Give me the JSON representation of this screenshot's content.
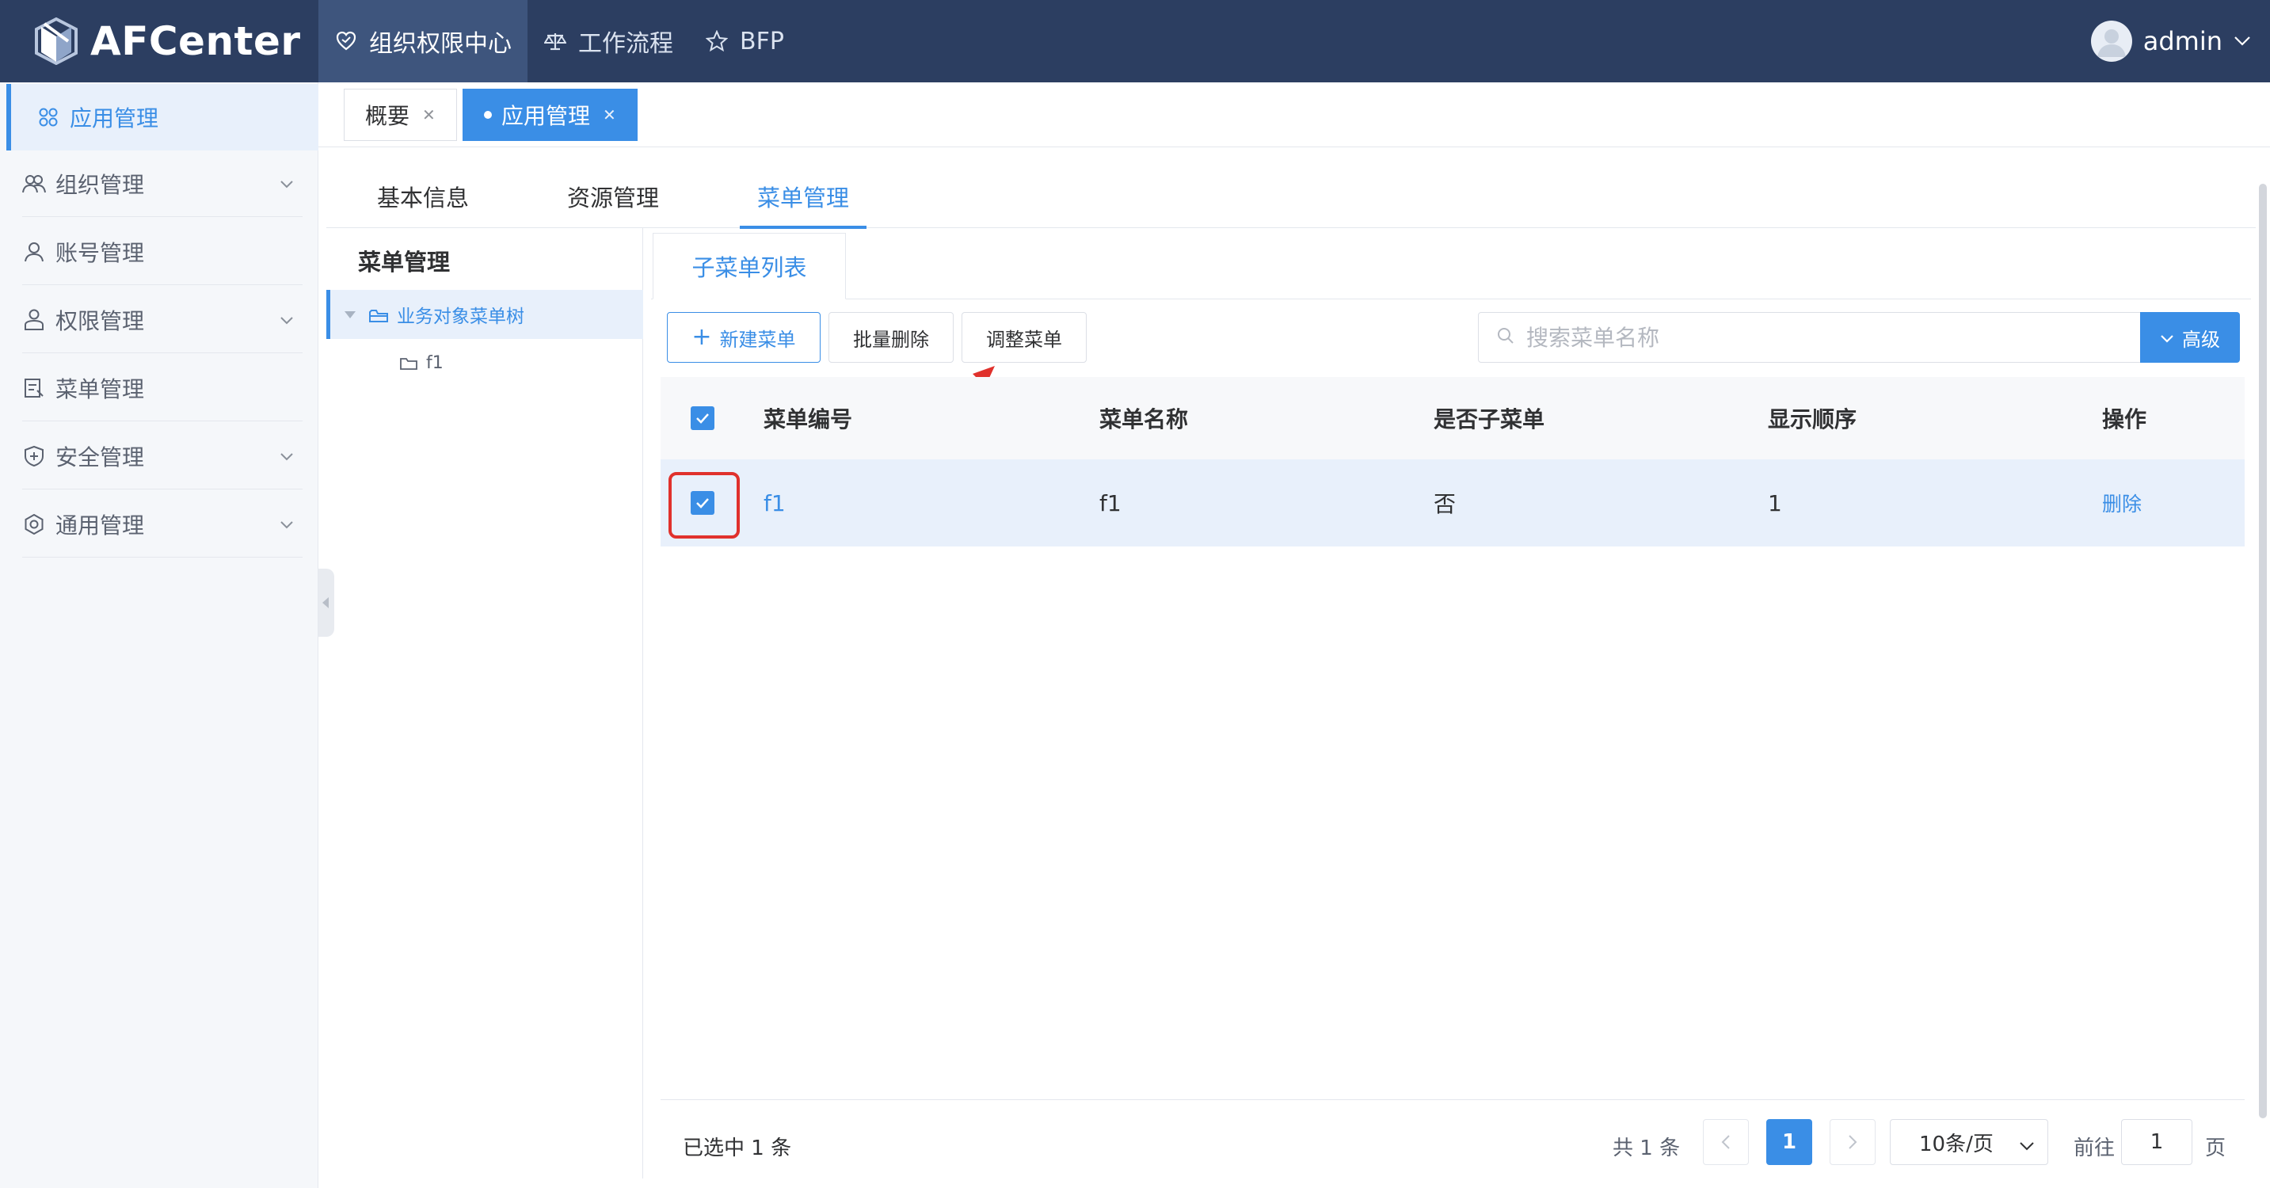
{
  "app": {
    "name": "AFCenter"
  },
  "nav": {
    "tabs": [
      {
        "label": "组织权限中心",
        "icon": "heart-shield-icon"
      },
      {
        "label": "工作流程",
        "icon": "balance-icon"
      },
      {
        "label": "BFP",
        "icon": "star-icon"
      }
    ]
  },
  "user": {
    "name": "admin"
  },
  "sidebar": {
    "items": [
      {
        "label": "应用管理",
        "icon": "grid-icon"
      },
      {
        "label": "组织管理",
        "icon": "group-icon"
      },
      {
        "label": "账号管理",
        "icon": "user-icon"
      },
      {
        "label": "权限管理",
        "icon": "lock-user-icon"
      },
      {
        "label": "菜单管理",
        "icon": "menu-doc-icon"
      },
      {
        "label": "安全管理",
        "icon": "shield-plus-icon"
      },
      {
        "label": "通用管理",
        "icon": "gear-icon"
      }
    ]
  },
  "page_tabs": [
    {
      "label": "概要"
    },
    {
      "label": "应用管理"
    }
  ],
  "sub_tabs": [
    "基本信息",
    "资源管理",
    "菜单管理"
  ],
  "tree": {
    "title": "菜单管理",
    "root": "业务对象菜单树",
    "child": "f1"
  },
  "panel": {
    "inner_tab": "子菜单列表",
    "buttons": {
      "new": "新建菜单",
      "batch_delete": "批量删除",
      "adjust": "调整菜单"
    },
    "search": {
      "placeholder": "搜索菜单名称",
      "value": ""
    },
    "advanced": "高级"
  },
  "table": {
    "columns": [
      "菜单编号",
      "菜单名称",
      "是否子菜单",
      "显示顺序",
      "操作"
    ],
    "rows": [
      {
        "code": "f1",
        "name": "f1",
        "is_sub": "否",
        "order": "1",
        "action": "删除",
        "checked": true
      }
    ]
  },
  "footer": {
    "selected": "已选中 1 条",
    "total": "共 1 条",
    "current_page": "1",
    "page_size": "10条/页",
    "goto_label": "前往",
    "goto_value": "1",
    "page_suffix": "页"
  },
  "colors": {
    "topbar": "#2c3e61",
    "accent": "#3a8ee6",
    "highlight": "#e0312c"
  }
}
